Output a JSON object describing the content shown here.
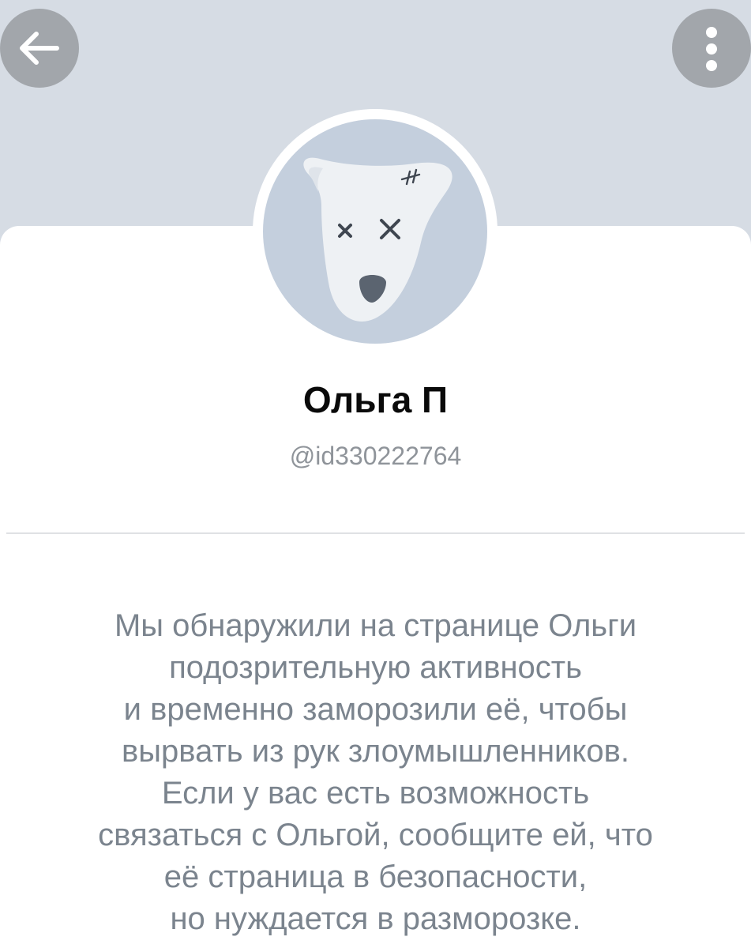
{
  "header": {
    "back_icon": "arrow-left-icon",
    "menu_icon": "vertical-dots-icon"
  },
  "profile": {
    "avatar_icon": "deactivated-dog-icon",
    "name": "Ольга П",
    "handle": "@id330222764"
  },
  "notice": {
    "lines": [
      "Мы обнаружили на странице Ольги",
      "подозрительную активность",
      "и временно заморозили её, чтобы",
      "вырвать из рук злоумышленников.",
      "Если у вас есть возможность",
      "связаться с Ольгой, сообщите ей, что",
      "её страница в безопасности,",
      "но нуждается в разморозке."
    ]
  },
  "colors": {
    "cover": "#d6dce4",
    "button_bg": "#a2a6ab",
    "avatar_bg": "#c4cfdd",
    "secondary_text": "#7b848e"
  }
}
